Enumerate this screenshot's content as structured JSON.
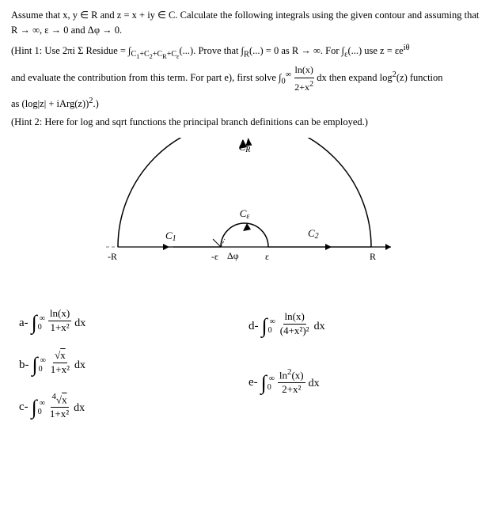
{
  "header": {
    "intro": "Assume that x, y ∈ R and z = x + iy ∈ C. Calculate the following integrals using the given contour and assuming that R → ∞, ε → 0 and Δφ → 0."
  },
  "hints": {
    "hint1_part1": "(Hint 1: Use  2πi Σ Residue = ∫",
    "hint1_contour": "C₁+C₂+Cᴿ+Cₑ",
    "hint1_part2": "(...). Prove that ∫ₑ(...) = 0 as R → ∞. For ∫ₑ(...) use z = εe^(iθ) and evaluate the contribution from this term. For part e), first solve ∫₀^∞ ln(x)/(2+x²) dx then expand log²(z) function as (log|z| + iArg(z))².)",
    "hint2": "(Hint 2: Here for log and sqrt functions the principal branch definitions can be employed.)"
  },
  "diagram": {
    "label_CR": "Cᴿ",
    "label_Ce": "Cₑ",
    "label_C1": "C₁",
    "label_C2": "C₂",
    "label_R": "R",
    "label_neg_R": "-R",
    "label_eps": "ε",
    "label_neg_eps": "-ε",
    "label_delta": "Δφ"
  },
  "integrals": {
    "a": {
      "label": "a-",
      "numer": "ln(x)",
      "denom": "1+x²",
      "dx": "dx",
      "lower": "0",
      "upper": "∞"
    },
    "b": {
      "label": "b-",
      "numer": "√x",
      "denom": "1+x²",
      "dx": "dx",
      "lower": "0",
      "upper": "∞"
    },
    "c": {
      "label": "c-",
      "numer": "⁴√x",
      "denom": "1+x²",
      "dx": "dx",
      "lower": "0",
      "upper": "∞"
    },
    "d": {
      "label": "d-",
      "numer": "ln(x)",
      "denom": "(4+x²)²",
      "dx": "dx",
      "lower": "0",
      "upper": "∞"
    },
    "e": {
      "label": "e-",
      "numer": "ln²(x)",
      "denom": "2+x²",
      "dx": "dx",
      "lower": "0",
      "upper": "∞"
    }
  },
  "colors": {
    "text": "#000000",
    "arc": "#000000",
    "line": "#7a7a7a"
  }
}
